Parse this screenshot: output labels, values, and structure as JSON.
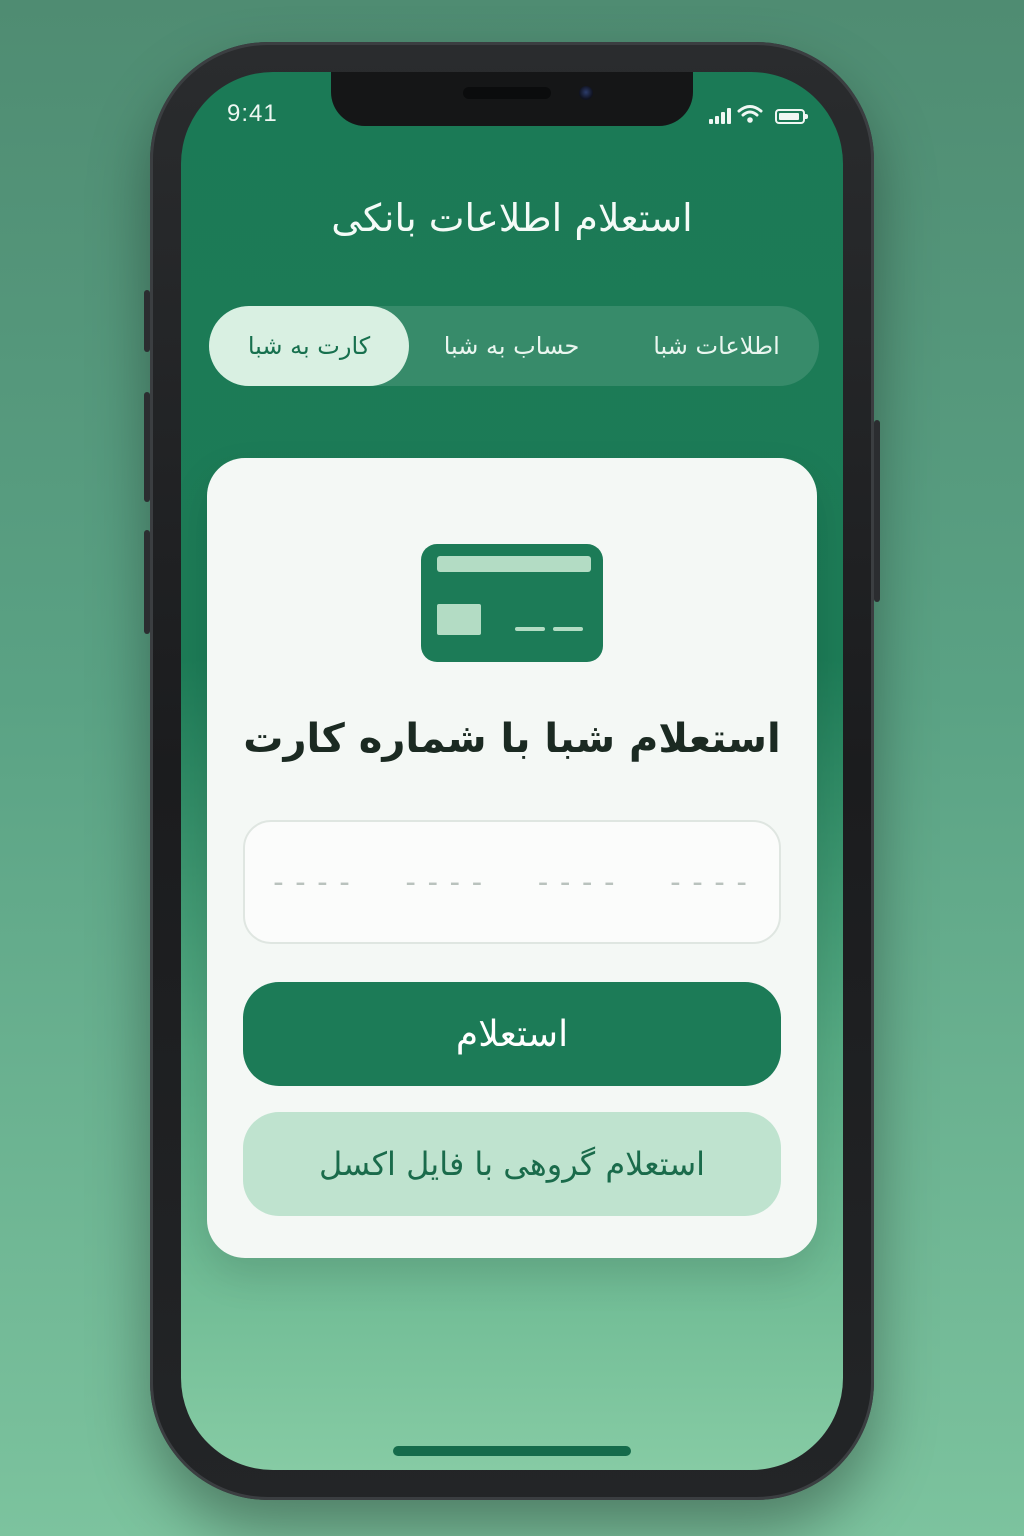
{
  "status_bar": {
    "time": "9:41",
    "icons": [
      "signal-icon",
      "wifi-icon",
      "battery-icon"
    ]
  },
  "header": {
    "title": "استعلام اطلاعات بانکی"
  },
  "tabs": [
    {
      "label": "اطلاعات شبا",
      "active": false
    },
    {
      "label": "حساب به شبا",
      "active": false
    },
    {
      "label": "کارت به شبا",
      "active": true
    }
  ],
  "card": {
    "icon": "credit-card-icon",
    "heading": "استعلام شبا با شماره کارت",
    "input_placeholder": "----  ----  ----  ----",
    "primary_button": "استعلام",
    "secondary_button": "استعلام گروهی با فایل اکسل"
  },
  "colors": {
    "primary": "#1c7b57",
    "primary_light": "#bfe3cf",
    "card_bg": "#f4f8f5",
    "active_tab_bg": "#d9f0e2"
  }
}
